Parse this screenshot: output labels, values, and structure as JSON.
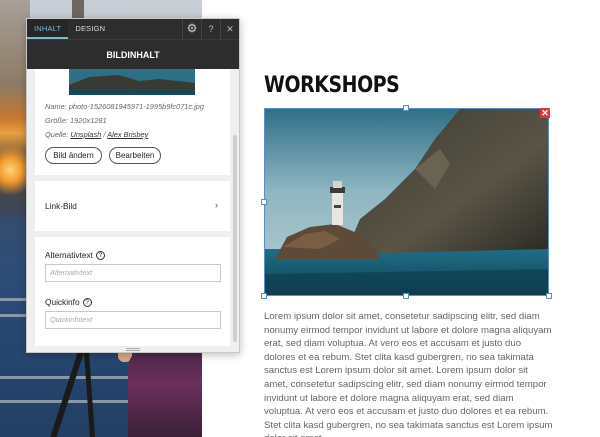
{
  "panel": {
    "tabs": [
      {
        "label": "INHALT",
        "active": true
      },
      {
        "label": "DESIGN",
        "active": false
      }
    ],
    "icons": {
      "settings": "gear-icon",
      "help": "question-icon",
      "close": "close-icon"
    },
    "help_glyph": "?",
    "close_glyph": "✕",
    "title": "BILDINHALT",
    "image_info": {
      "name": "Name: photo-1526081945971-1995b9fc071c.jpg",
      "size": "Größe: 1920x1281",
      "source_prefix": "Quelle:",
      "source_site": "Unsplash",
      "source_separator": "/",
      "source_author": "Alex Brisbey"
    },
    "buttons": {
      "change": "Bild ändern",
      "edit": "Bearbeiten"
    },
    "link_image_label": "Link-Bild",
    "alt_text": {
      "label": "Alternativtext",
      "placeholder": "Alternativtext",
      "help": "?"
    },
    "tooltip": {
      "label": "Quickinfo",
      "placeholder": "Quickinfotext",
      "help": "?"
    }
  },
  "content": {
    "headline": "WORKSHOPS",
    "delete_glyph": "✕",
    "body": "Lorem ipsum dolor sit amet, consetetur sadipscing elitr, sed diam nonumy eirmod tempor invidunt ut labore et dolore magna aliquyam erat, sed diam voluptua. At vero eos et accusam et justo duo dolores et ea rebum. Stet clita kasd gubergren, no sea takimata sanctus est Lorem ipsum dolor sit amet. Lorem ipsum dolor sit amet, consetetur sadipscing elitr, sed diam nonumy eirmod tempor invidunt ut labore et dolore magna aliquyam erat, sed diam voluptua. At vero eos et accusam et justo duo dolores et ea rebum. Stet clita kasd gubergren, no sea takimata sanctus est Lorem ipsum dolor sit amet."
  },
  "colors": {
    "selection": "#5b8ec9",
    "active_tab": "#7ab8d6",
    "panel_dark": "#2d2d2d",
    "delete": "#d93a3a"
  }
}
